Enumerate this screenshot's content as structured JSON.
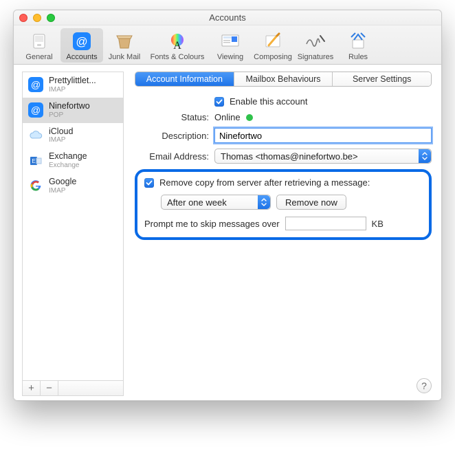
{
  "window": {
    "title": "Accounts"
  },
  "toolbar": {
    "items": [
      {
        "label": "General"
      },
      {
        "label": "Accounts"
      },
      {
        "label": "Junk Mail"
      },
      {
        "label": "Fonts & Colours"
      },
      {
        "label": "Viewing"
      },
      {
        "label": "Composing"
      },
      {
        "label": "Signatures"
      },
      {
        "label": "Rules"
      }
    ]
  },
  "sidebar": {
    "accounts": [
      {
        "name": "Prettylittlet...",
        "type": "IMAP"
      },
      {
        "name": "Ninefortwo",
        "type": "POP"
      },
      {
        "name": "iCloud",
        "type": "IMAP"
      },
      {
        "name": "Exchange",
        "type": "Exchange"
      },
      {
        "name": "Google",
        "type": "IMAP"
      }
    ]
  },
  "tabs": {
    "items": [
      {
        "label": "Account Information"
      },
      {
        "label": "Mailbox Behaviours"
      },
      {
        "label": "Server Settings"
      }
    ]
  },
  "form": {
    "enable_label": "Enable this account",
    "status_label": "Status:",
    "status_value": "Online",
    "description_label": "Description:",
    "description_value": "Ninefortwo",
    "email_label": "Email Address:",
    "email_value": "Thomas <thomas@ninefortwo.be>"
  },
  "pop": {
    "remove_label": "Remove copy from server after retrieving a message:",
    "after_value": "After one week",
    "remove_now": "Remove now",
    "skip_label": "Prompt me to skip messages over",
    "skip_value": "",
    "skip_unit": "KB"
  },
  "footer": {
    "plus": "+",
    "minus": "−"
  },
  "help": {
    "label": "?"
  }
}
